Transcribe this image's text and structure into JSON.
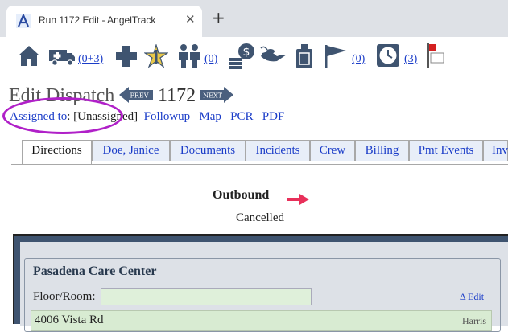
{
  "browser": {
    "tab_title": "Run 1172 Edit - AngelTrack",
    "close_glyph": "✕",
    "new_tab_glyph": "+"
  },
  "toolbar": {
    "icons": [
      "home-icon",
      "ambulance-icon",
      "medical-cross-icon",
      "star-of-life-icon",
      "crew-icon",
      "money-icon",
      "lamp-icon",
      "fuel-can-icon",
      "flag-icon",
      "clock-icon",
      "red-flag-icon"
    ],
    "ambulance_count": "(0+3)",
    "crew_count": "(0)",
    "flag_count": "(0)",
    "clock_count": "(3)"
  },
  "heading": {
    "title": "Edit Dispatch",
    "prev_label": "PREV",
    "run_number": "1172",
    "next_label": "NEXT"
  },
  "links": {
    "assigned_label": "Assigned to",
    "colon": ":",
    "assigned_value": "[Unassigned]",
    "followup": "Followup",
    "map": "Map",
    "pcr": "PCR",
    "pdf": "PDF"
  },
  "tabs": [
    {
      "label": "Directions"
    },
    {
      "label": "Doe, Janice"
    },
    {
      "label": "Documents"
    },
    {
      "label": "Incidents"
    },
    {
      "label": "Crew"
    },
    {
      "label": "Billing"
    },
    {
      "label": "Pmt Events"
    },
    {
      "label": "Inv"
    }
  ],
  "trip": {
    "direction": "Outbound",
    "status": "Cancelled"
  },
  "location": {
    "name": "Pasadena Care Center",
    "floor_label": "Floor/Room:",
    "floor_value": "",
    "edit_link": "Δ Edit",
    "address": "4006 Vista Rd",
    "address_side": "Harris"
  },
  "colors": {
    "accent_link": "#1a3cc8",
    "panel": "#3f5470",
    "highlight_circle": "#b020c8",
    "arrow": "#e8305a"
  }
}
